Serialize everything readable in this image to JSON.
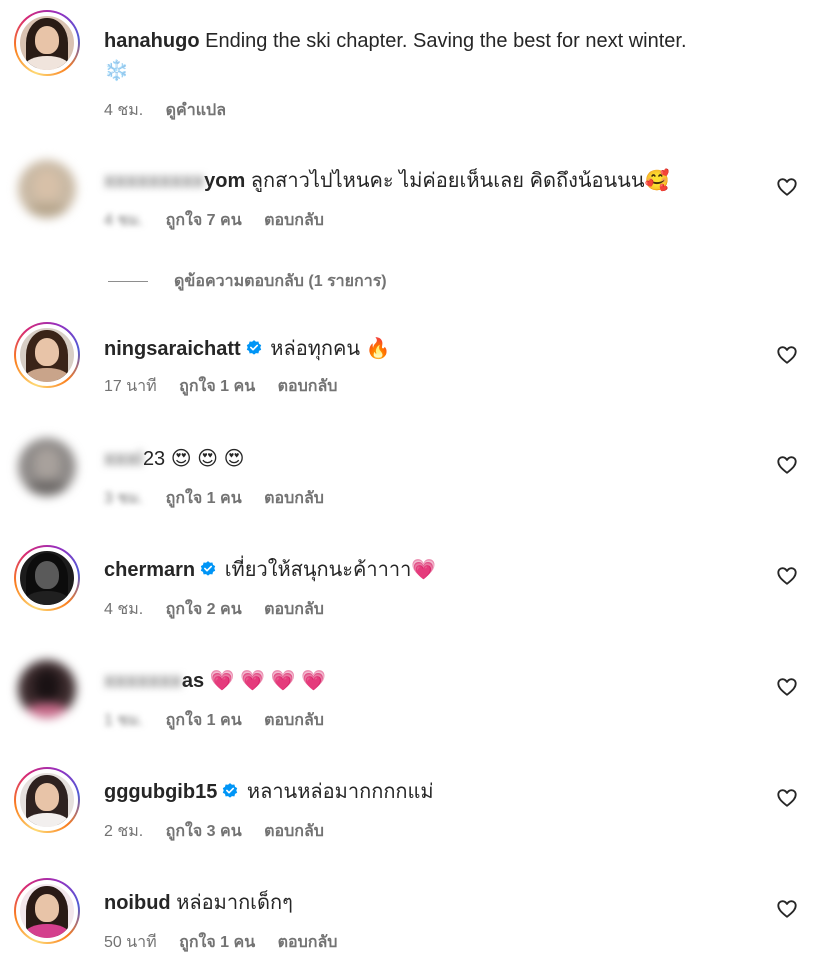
{
  "post": {
    "username": "hanahugo",
    "caption": "Ending the ski chapter. Saving the best for next winter.",
    "caption_emoji": "❄️",
    "time": "4 ชม.",
    "translate_label": "ดูคำแปล"
  },
  "comments": [
    {
      "username_visible": "yom",
      "username_blurred": "xxxxxxxxx",
      "text": "ลูกสาวไปไหนคะ ไม่ค่อยเห็นเลย คิดถึงน้อนนน",
      "emoji": "🥰",
      "time": "4 ชม.",
      "likes": "ถูกใจ 7 คน",
      "reply": "ตอบกลับ",
      "verified": false
    },
    {
      "username_visible": "ningsaraichatt",
      "text": "หล่อทุกคน",
      "emoji": "🔥",
      "time": "17 นาที",
      "likes": "ถูกใจ 1 คน",
      "reply": "ตอบกลับ",
      "verified": true
    },
    {
      "username_visible": "23",
      "username_blurred": "xxxi",
      "text": "",
      "emoji": "😍 😍 😍",
      "time": "3 ชม.",
      "likes": "ถูกใจ 1 คน",
      "reply": "ตอบกลับ",
      "verified": false
    },
    {
      "username_visible": "chermarn",
      "text": "เที่ยวให้สนุกนะค้าาาา",
      "emoji": "💗",
      "time": "4 ชม.",
      "likes": "ถูกใจ 2 คน",
      "reply": "ตอบกลับ",
      "verified": true
    },
    {
      "username_visible": "as",
      "username_blurred": "xxxxxxx",
      "text": "",
      "emoji": "💗 💗 💗 💗",
      "time": "1 ชม.",
      "likes": "ถูกใจ 1 คน",
      "reply": "ตอบกลับ",
      "verified": false
    },
    {
      "username_visible": "gggubgib15",
      "text": "หลานหล่อมากกกกแม่",
      "emoji": "",
      "time": "2 ชม.",
      "likes": "ถูกใจ 3 คน",
      "reply": "ตอบกลับ",
      "verified": true
    },
    {
      "username_visible": "noibud",
      "text": "หล่อมากเด็กๆ",
      "emoji": "",
      "time": "50 นาที",
      "likes": "ถูกใจ 1 คน",
      "reply": "ตอบกลับ",
      "verified": false
    }
  ],
  "view_replies_label": "ดูข้อความตอบกลับ (1 รายการ)",
  "colors": {
    "text": "#262626",
    "meta": "#737373",
    "verified": "#0095f6",
    "heart_outline": "#262626"
  },
  "icons": {
    "like": "heart-outline-icon",
    "verified": "verified-badge-icon"
  }
}
